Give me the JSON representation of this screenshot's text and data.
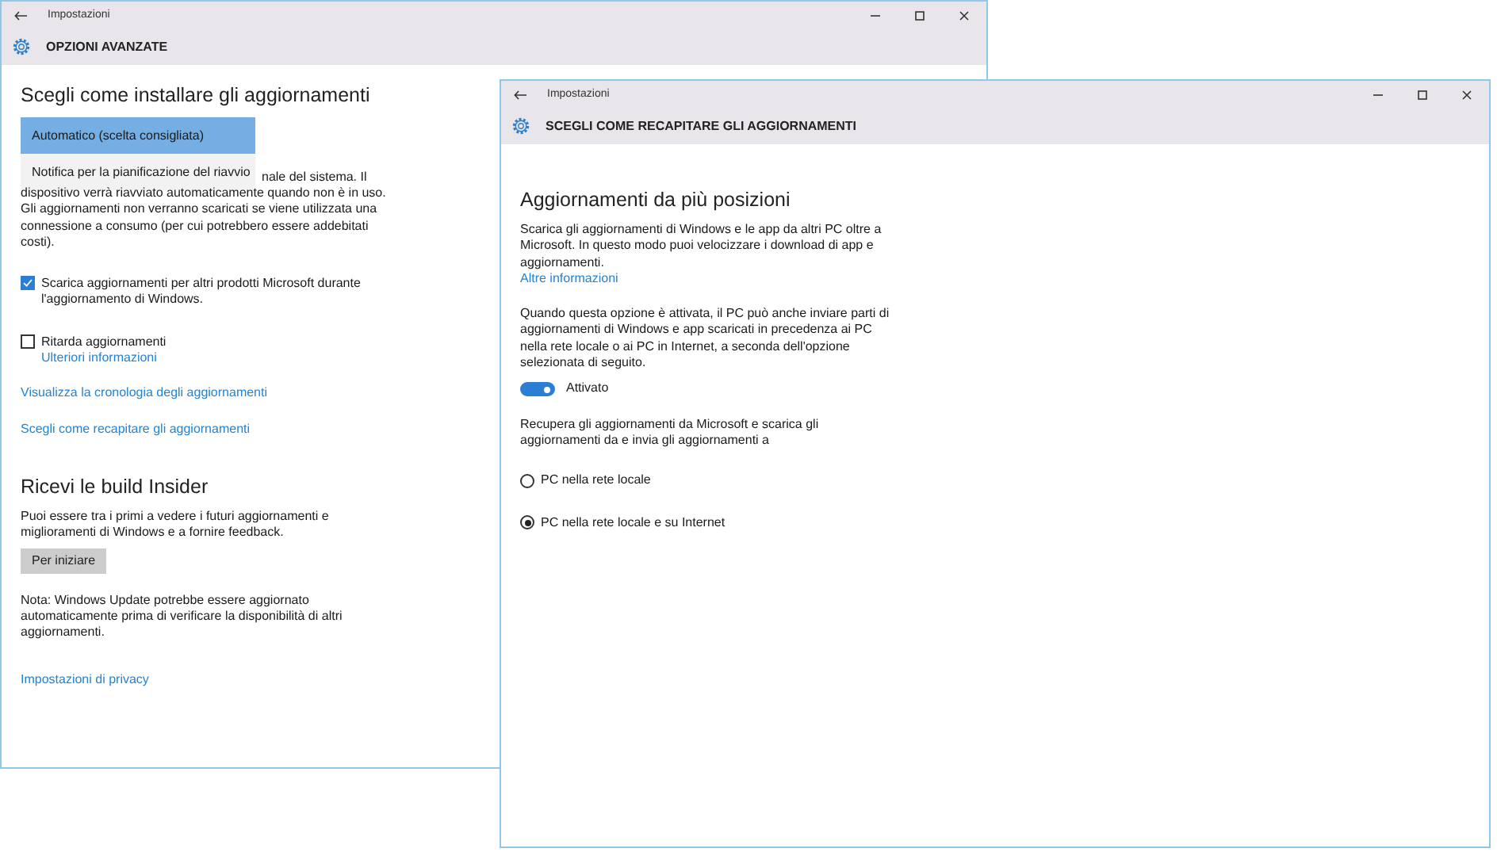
{
  "windows": [
    {
      "app_title": "Impostazioni",
      "page_title": "OPZIONI AVANZATE",
      "content": [
        {
          "kind": "heading",
          "text": "Scegli come installare gli aggiornamenti"
        },
        {
          "kind": "dropdown",
          "options": [
            {
              "label": "Automatico (scelta consigliata)",
              "selected": true
            },
            {
              "label": "Notifica per la pianificazione del riavvio",
              "selected": false
            }
          ],
          "covered_text": "nale del sistema. Il"
        },
        {
          "kind": "paragraph",
          "text": "dispositivo verrà riavviato automaticamente quando non è in uso. Gli aggiornamenti non verranno scaricati se viene utilizzata una connessione a consumo (per cui potrebbero essere addebitati costi)."
        },
        {
          "kind": "checkbox",
          "label": "Scarica aggiornamenti per altri prodotti Microsoft durante l'aggiornamento di Windows.",
          "checked": true
        },
        {
          "kind": "checkbox",
          "label": "Ritarda aggiornamenti",
          "checked": false,
          "link": "Ulteriori informazioni"
        },
        {
          "kind": "link",
          "text": "Visualizza la cronologia degli aggiornamenti"
        },
        {
          "kind": "link",
          "text": "Scegli come recapitare gli aggiornamenti"
        },
        {
          "kind": "heading",
          "text": "Ricevi le build Insider"
        },
        {
          "kind": "paragraph",
          "text": "Puoi essere tra i primi a vedere i futuri aggiornamenti e miglioramenti di Windows e a fornire feedback."
        },
        {
          "kind": "button",
          "text": "Per iniziare"
        },
        {
          "kind": "paragraph",
          "text": "Nota: Windows Update potrebbe essere aggiornato automaticamente prima di verificare la disponibilità di altri aggiornamenti."
        },
        {
          "kind": "link",
          "text": "Impostazioni di privacy"
        }
      ]
    },
    {
      "app_title": "Impostazioni",
      "page_title": "SCEGLI COME RECAPITARE GLI AGGIORNAMENTI",
      "content": [
        {
          "kind": "heading",
          "text": "Aggiornamenti da più posizioni"
        },
        {
          "kind": "paragraph",
          "text": "Scarica gli aggiornamenti di Windows e le app da altri PC oltre a Microsoft. In questo modo puoi velocizzare i download di app e aggiornamenti."
        },
        {
          "kind": "link",
          "text": "Altre informazioni"
        },
        {
          "kind": "paragraph",
          "text": "Quando questa opzione è attivata, il PC può anche inviare parti di aggiornamenti di Windows e app scaricati in precedenza ai PC nella rete locale o ai PC in Internet, a seconda dell'opzione selezionata di seguito."
        },
        {
          "kind": "toggle",
          "label": "Attivato",
          "on": true
        },
        {
          "kind": "paragraph",
          "text": "Recupera gli aggiornamenti da Microsoft e scarica gli aggiornamenti da e invia gli aggiornamenti a"
        },
        {
          "kind": "radio",
          "label": "PC nella rete locale",
          "selected": false
        },
        {
          "kind": "radio",
          "label": "PC nella rete locale e su Internet",
          "selected": true
        }
      ]
    }
  ]
}
